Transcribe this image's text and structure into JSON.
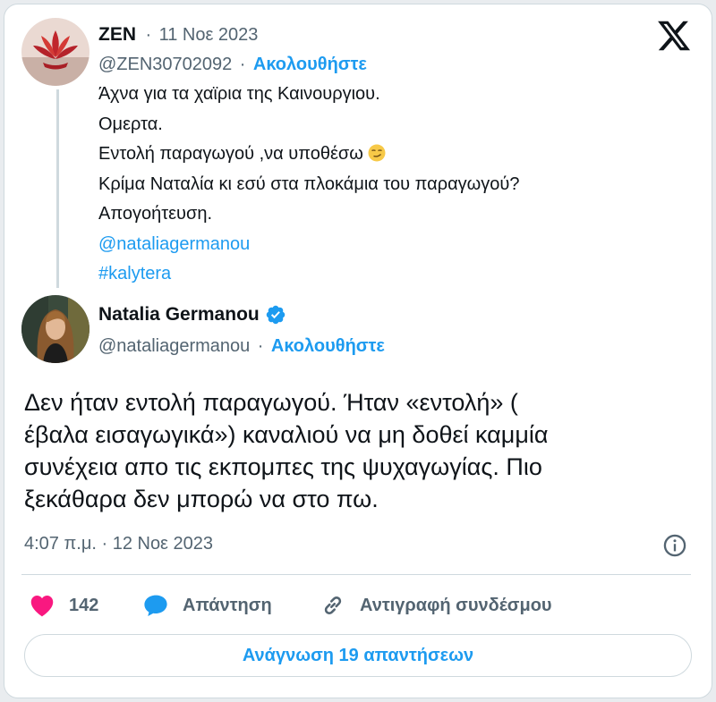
{
  "quoted_tweet": {
    "author_name": "ZEN",
    "separator": "·",
    "date": "11 Νοε 2023",
    "handle": "@ZEN30702092",
    "follow_label": "Ακολουθήστε",
    "lines": [
      "Άχνα για τα χαϊρια της Καινουργιου.",
      "Ομερτα.",
      "Εντολή παραγωγού ,να υποθέσω",
      "Κρίμα Ναταλία κι εσύ στα πλοκάμια του παραγωγού?",
      "Απογοήτευση."
    ],
    "mention": "@nataliagermanou",
    "hashtag": "#kalytera"
  },
  "reply_tweet": {
    "author_name": "Natalia Germanou",
    "verified": true,
    "handle": "@nataliagermanou",
    "separator": "·",
    "follow_label": "Ακολουθήστε",
    "text_lines": [
      "Δεν ήταν εντολή παραγωγού. Ήταν «εντολή» (",
      "έβαλα εισαγωγικά») καναλιού να μη δοθεί καμμία",
      "συνέχεια απο τις εκπομπες της ψυχαγωγίας. Πιο",
      "ξεκάθαρα δεν μπορώ να στο πω."
    ],
    "timestamp": "4:07 π.μ. · 12 Νοε 2023"
  },
  "actions": {
    "like_count": "142",
    "reply_label": "Απάντηση",
    "copy_link_label": "Αντιγραφή συνδέσμου",
    "read_replies_label": "Ανάγνωση 19 απαντήσεων"
  },
  "icons": {
    "logo": "x-logo-icon",
    "verified": "verified-badge-icon",
    "info": "info-icon",
    "like": "heart-icon",
    "reply": "reply-bubble-icon",
    "copy_link": "link-icon",
    "emoji": "smirking-face-icon"
  },
  "colors": {
    "accent": "#1d9bf0",
    "like": "#f91880",
    "text": "#0f1419",
    "muted": "#536471",
    "border": "#cfd9de"
  }
}
